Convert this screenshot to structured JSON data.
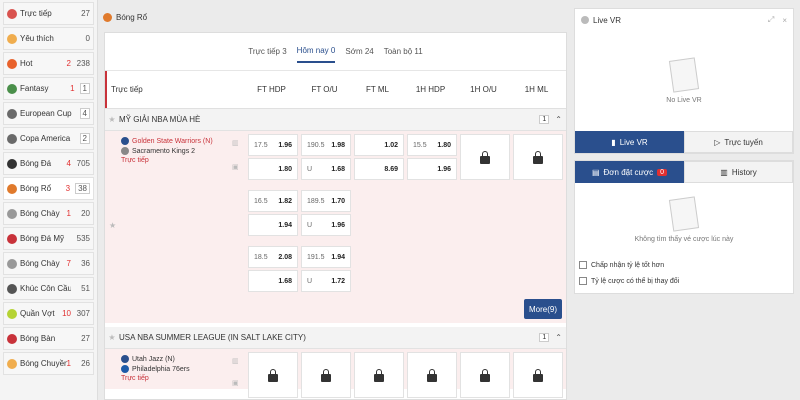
{
  "sidebar": {
    "items": [
      {
        "label": "Trực tiếp",
        "red": "",
        "count": "27",
        "icon": "live-icon",
        "color": "#d9534f"
      },
      {
        "label": "Yêu thích",
        "red": "",
        "count": "0",
        "icon": "star-icon",
        "color": "#f0ad4e"
      },
      {
        "label": "Hot",
        "red": "2",
        "count": "238",
        "icon": "fire-icon",
        "color": "#e8622c"
      },
      {
        "label": "Fantasy",
        "red": "1",
        "count": "1",
        "icon": "fantasy-icon",
        "color": "#4a8f4a"
      },
      {
        "label": "European Cup",
        "red": "",
        "count": "4",
        "icon": "trophy-icon",
        "color": "#6a6a6a"
      },
      {
        "label": "Copa America",
        "red": "",
        "count": "2",
        "icon": "trophy-icon",
        "color": "#6a6a6a"
      },
      {
        "label": "Bóng Đá",
        "red": "4",
        "count": "705",
        "icon": "soccer-icon",
        "color": "#333333"
      },
      {
        "label": "Bóng Rổ",
        "red": "3",
        "count": "38",
        "icon": "basketball-icon",
        "color": "#e07a2c"
      },
      {
        "label": "Bóng Chày",
        "red": "1",
        "count": "20",
        "icon": "baseball-icon",
        "color": "#999999"
      },
      {
        "label": "Bóng Đá Mỹ",
        "red": "",
        "count": "535",
        "icon": "football-icon",
        "color": "#c8323a"
      },
      {
        "label": "Bóng Chày",
        "red": "7",
        "count": "36",
        "icon": "baseball-icon",
        "color": "#999999"
      },
      {
        "label": "Khúc Côn Cầu",
        "red": "",
        "count": "51",
        "icon": "hockey-icon",
        "color": "#555555"
      },
      {
        "label": "Quần Vợt",
        "red": "10",
        "count": "307",
        "icon": "tennis-icon",
        "color": "#b5d334"
      },
      {
        "label": "Bóng Bàn",
        "red": "",
        "count": "27",
        "icon": "pingpong-icon",
        "color": "#c8323a"
      },
      {
        "label": "Bóng Chuyền",
        "red": "1",
        "count": "26",
        "icon": "volleyball-icon",
        "color": "#f0ad4e"
      }
    ]
  },
  "main": {
    "title": "Bóng Rổ",
    "tabs": [
      "Trực tiếp 3",
      "Hôm nay 0",
      "Sớm 24",
      "Toàn bộ 11"
    ],
    "columns": [
      "Trực tiếp",
      "FT HDP",
      "FT O/U",
      "FT ML",
      "1H HDP",
      "1H O/U",
      "1H ML"
    ],
    "league1": {
      "name": "MỸ GIẢI NBA MÙA HÈ",
      "num": "1"
    },
    "match1": {
      "home": "Golden State Warriors (N)",
      "away": "Sacramento Kings 2",
      "status": "Trực tiếp",
      "r1": {
        "h1": "17.5",
        "o1": "1.96",
        "h2": "190.5",
        "o2": "1.98",
        "o3": "1.02",
        "h4": "15.5",
        "o4": "1.80"
      },
      "r2": {
        "o1": "1.80",
        "h2": "U",
        "o2": "1.68",
        "o3": "8.69",
        "o4": "1.96"
      },
      "r3": {
        "h1": "16.5",
        "o1": "1.82",
        "h2": "189.5",
        "o2": "1.70"
      },
      "r4": {
        "o1": "1.94",
        "h2": "U",
        "o2": "1.96"
      },
      "r5": {
        "h1": "18.5",
        "o1": "2.08",
        "h2": "191.5",
        "o2": "1.94"
      },
      "r6": {
        "o1": "1.68",
        "h2": "U",
        "o2": "1.72"
      },
      "more": "More(9)"
    },
    "league2": {
      "name": "USA NBA SUMMER LEAGUE (IN SALT LAKE CITY)",
      "num": "1"
    },
    "match2": {
      "home": "Utah Jazz (N)",
      "away": "Philadelphia 76ers",
      "status": "Trực tiếp"
    }
  },
  "right": {
    "livevr_title": "Live VR",
    "no_live": "No Live VR",
    "tab_livevr": "Live VR",
    "tab_online": "Trực tuyến",
    "tab_bets": "Đơn đặt cược",
    "bets_badge": "0",
    "tab_history": "History",
    "no_bets": "Không tìm thấy vé cược lúc này",
    "chk1": "Chấp nhận tỷ lệ tốt hơn",
    "chk2": "Tỷ lệ cược có thể bị thay đổi"
  }
}
